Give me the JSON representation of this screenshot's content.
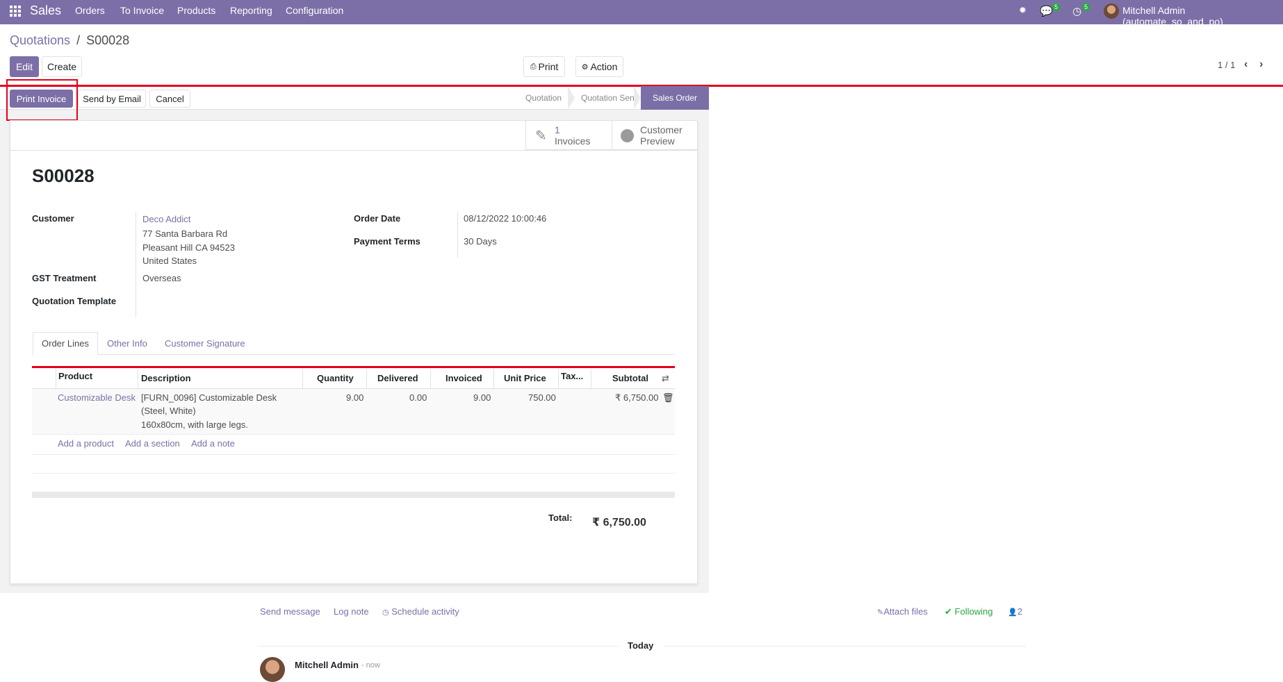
{
  "navbar": {
    "brand": "Sales",
    "menu": [
      "Orders",
      "To Invoice",
      "Products",
      "Reporting",
      "Configuration"
    ],
    "messages_count": "5",
    "activities_count": "5",
    "user": "Mitchell Admin (automate_so_and_po)"
  },
  "breadcrumb": {
    "parent": "Quotations",
    "separator": "/",
    "current": "S00028"
  },
  "control": {
    "edit": "Edit",
    "create": "Create",
    "print": "Print",
    "action": "Action",
    "pager": "1 / 1"
  },
  "statusbar": {
    "buttons": [
      "Print Invoice",
      "Send by Email",
      "Cancel"
    ],
    "stages": [
      "Quotation",
      "Quotation Sent",
      "Sales Order"
    ],
    "active_stage": "Sales Order"
  },
  "smart_buttons": {
    "invoices_count": "1",
    "invoices_label": "Invoices",
    "customer_preview_1": "Customer",
    "customer_preview_2": "Preview"
  },
  "record": {
    "name": "S00028",
    "customer_label": "Customer",
    "customer_name": "Deco Addict",
    "customer_address": [
      "77 Santa Barbara Rd",
      "Pleasant Hill CA 94523",
      "United States"
    ],
    "gst_label": "GST Treatment",
    "gst_value": "Overseas",
    "template_label": "Quotation Template",
    "order_date_label": "Order Date",
    "order_date": "08/12/2022 10:00:46",
    "payment_terms_label": "Payment Terms",
    "payment_terms": "30 Days"
  },
  "tabs": [
    "Order Lines",
    "Other Info",
    "Customer Signature"
  ],
  "order_lines": {
    "columns": [
      "Product",
      "Description",
      "Quantity",
      "Delivered",
      "Invoiced",
      "Unit Price",
      "Tax...",
      "Subtotal"
    ],
    "rows": [
      {
        "product": "Customizable Desk",
        "description": [
          "[FURN_0096] Customizable Desk",
          "(Steel, White)",
          "160x80cm, with large legs."
        ],
        "quantity": "9.00",
        "delivered": "0.00",
        "invoiced": "9.00",
        "unit_price": "750.00",
        "subtotal": "₹ 6,750.00"
      }
    ],
    "add_links": [
      "Add a product",
      "Add a section",
      "Add a note"
    ]
  },
  "totals": {
    "label": "Total:",
    "value": "₹ 6,750.00"
  },
  "chatter": {
    "send_message": "Send message",
    "log_note": "Log note",
    "schedule_activity": "Schedule activity",
    "attach_files": "Attach files",
    "following": "Following",
    "followers": "2",
    "today": "Today",
    "author": "Mitchell Admin",
    "time": "- now"
  },
  "colors": {
    "primary": "#7c6fa7",
    "highlight": "#e3001b",
    "success": "#28a745"
  }
}
